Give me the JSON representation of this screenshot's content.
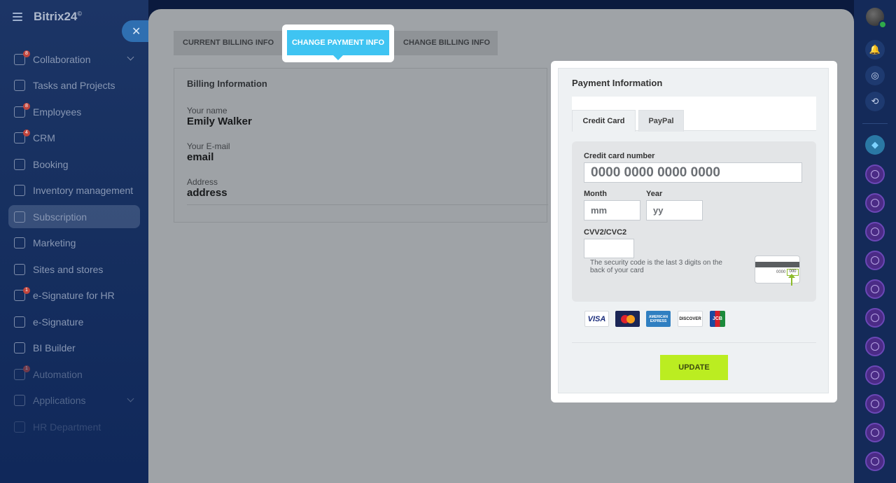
{
  "app": {
    "brand": "Bitrix24",
    "brand_mark": "©"
  },
  "sidebar": {
    "items": [
      {
        "label": "Collaboration",
        "icon": "chat-icon",
        "badge": "8",
        "chevron": true
      },
      {
        "label": "Tasks and Projects",
        "icon": "checkbox-icon"
      },
      {
        "label": "Employees",
        "icon": "people-icon",
        "badge": "8"
      },
      {
        "label": "CRM",
        "icon": "funnel-icon",
        "badge": "4"
      },
      {
        "label": "Booking",
        "icon": "calendar-icon"
      },
      {
        "label": "Inventory management",
        "icon": "box-icon"
      },
      {
        "label": "Subscription",
        "icon": "subscription-icon",
        "active": true
      },
      {
        "label": "Marketing",
        "icon": "target-icon"
      },
      {
        "label": "Sites and stores",
        "icon": "cart-icon"
      },
      {
        "label": "e-Signature for HR",
        "icon": "document-icon",
        "badge": "1"
      },
      {
        "label": "e-Signature",
        "icon": "pen-icon"
      },
      {
        "label": "BI Builder",
        "icon": "chart-icon"
      },
      {
        "label": "Automation",
        "icon": "robot-icon",
        "badge": "1"
      },
      {
        "label": "Applications",
        "icon": "apps-icon",
        "chevron": true
      },
      {
        "label": "HR Department",
        "icon": "hr-icon"
      }
    ]
  },
  "tabs": {
    "current_billing": "CURRENT BILLING INFO",
    "change_payment": "CHANGE PAYMENT INFO",
    "change_billing": "CHANGE BILLING INFO"
  },
  "billing": {
    "title": "Billing Information",
    "name_label": "Your name",
    "name_value": "Emily Walker",
    "email_label": "Your E-mail",
    "email_value": "email",
    "address_label": "Address",
    "address_value": "address"
  },
  "payment": {
    "title": "Payment Information",
    "tab_credit_card": "Credit Card",
    "tab_paypal": "PayPal",
    "card_number_label": "Credit card number",
    "card_number_placeholder": "0000 0000 0000 0000",
    "month_label": "Month",
    "month_placeholder": "mm",
    "year_label": "Year",
    "year_placeholder": "yy",
    "cvv_label": "CVV2/CVC2",
    "cvv_note": "The security code is the last 3 digits on the back of your card",
    "card_sample_number": "0000",
    "card_sample_cvv": "000",
    "logos": [
      "VISA",
      "MasterCard",
      "AMERICAN EXPRESS",
      "DISCOVER",
      "JCB"
    ],
    "update_button": "UPDATE"
  },
  "colors": {
    "accent_tab": "#3fc4f2",
    "update_button": "#bbed21",
    "sidebar_bg": "#173060"
  }
}
